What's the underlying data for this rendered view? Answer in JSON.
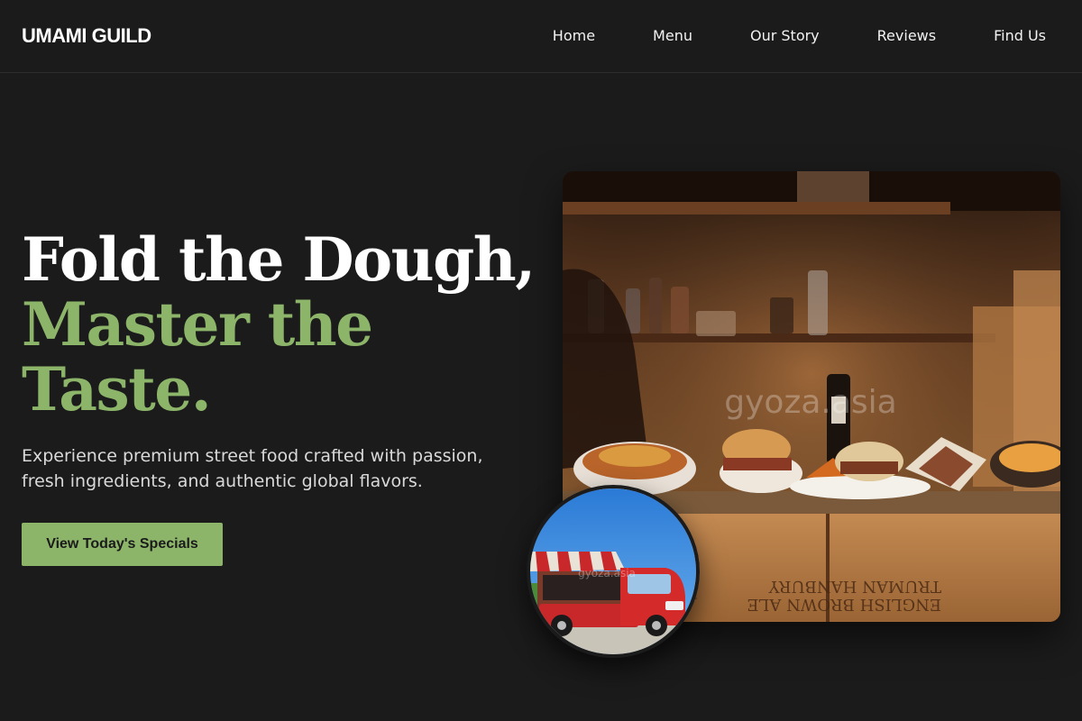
{
  "brand": {
    "name": "UMAMI GUILD"
  },
  "nav": {
    "items": [
      {
        "label": "Home"
      },
      {
        "label": "Menu"
      },
      {
        "label": "Our Story"
      },
      {
        "label": "Reviews"
      },
      {
        "label": "Find Us"
      }
    ]
  },
  "hero": {
    "title_line1": "Fold the Dough,",
    "title_line2": "Master the",
    "title_line3": "Taste.",
    "subtitle": "Experience premium street food crafted with passion, fresh ingredients, and authentic global flavors.",
    "cta_label": "View Today's Specials"
  },
  "images": {
    "main_alt": "Street food platters on wooden crates",
    "main_watermark": "gyoza.asia",
    "circle_alt": "Red food truck van",
    "circle_watermark": "gyoza.asia"
  },
  "colors": {
    "background": "#1b1b1b",
    "accent": "#8cb56a",
    "text": "#ffffff"
  }
}
